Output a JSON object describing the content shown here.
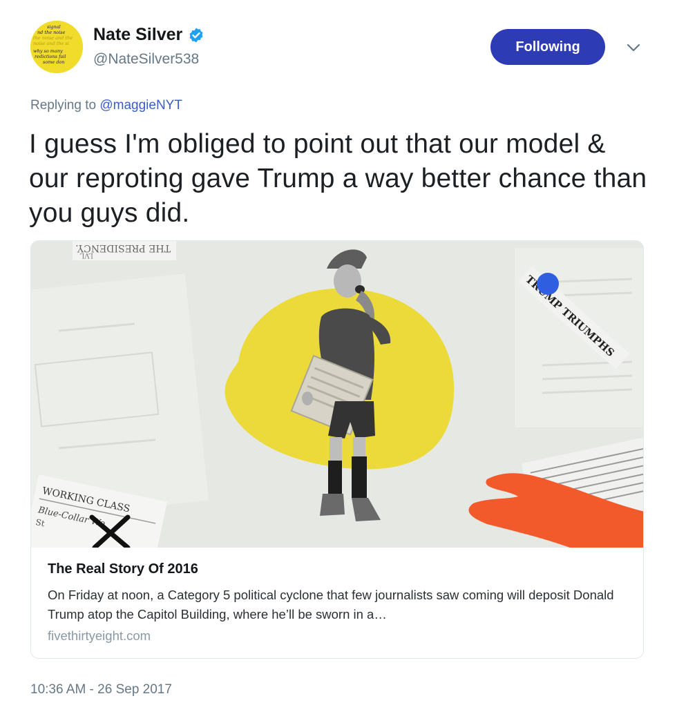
{
  "author": {
    "display_name": "Nate Silver",
    "handle": "@NateSilver538",
    "verified": true,
    "avatar_text": [
      "signal",
      "nd the noise",
      "the noise and the",
      "noise and the si",
      "why so many",
      "redictions fail",
      "some don"
    ]
  },
  "follow_button": {
    "label": "Following",
    "color": "#2d3bb5"
  },
  "reply": {
    "prefix": "Replying to ",
    "mention": "@maggieNYT"
  },
  "tweet": {
    "text": "I guess I'm obliged to point out that our model & our reproting gave Trump a way better chance than you guys did."
  },
  "card": {
    "image": {
      "clipping_top": "THE PRESIDENCY.",
      "clipping_top_prefix": "LVL",
      "clipping_right": "TRUMP TRIUMPHS",
      "clipping_bottom_left_1": "WORKING CLASS",
      "clipping_bottom_left_2": "Blue-Collar Wo",
      "clipping_bottom_left_3": "St",
      "colors": {
        "yellow": "#ecd93a",
        "orange": "#f25a2c",
        "blue": "#2f5fe0",
        "background": "#e6e8e3"
      }
    },
    "title": "The Real Story Of 2016",
    "description": "On Friday at noon, a Category 5 political cyclone that few journalists saw coming will deposit Donald Trump atop the Capitol Building, where he’ll be sworn in a…",
    "domain": "fivethirtyeight.com"
  },
  "timestamp": "10:36 AM - 26 Sep 2017",
  "icons": {
    "verified": "verified-badge-icon",
    "caret": "chevron-down-icon"
  },
  "colors": {
    "link": "#3b5bcc",
    "muted": "#657786",
    "verified_blue": "#1da1f2"
  }
}
